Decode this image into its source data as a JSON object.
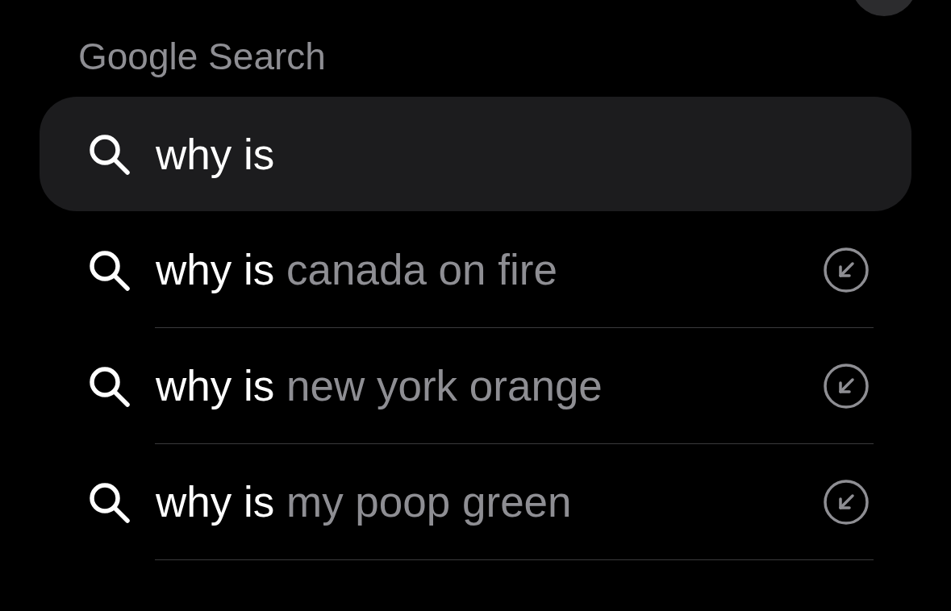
{
  "heading": "Google Search",
  "search": {
    "value": "why is"
  },
  "suggestions": [
    {
      "typed": "why is",
      "completion": "canada on fire"
    },
    {
      "typed": "why is",
      "completion": "new york orange"
    },
    {
      "typed": "why is",
      "completion": "my poop green"
    }
  ]
}
